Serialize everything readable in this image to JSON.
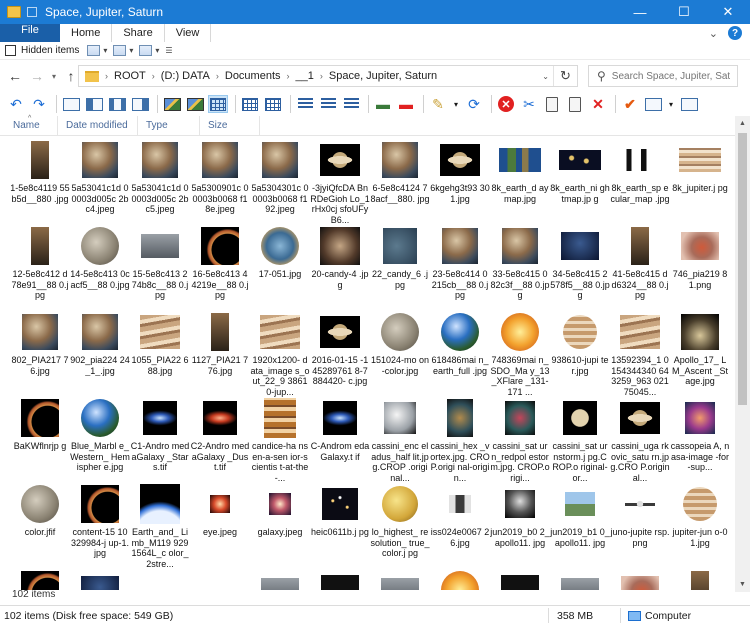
{
  "window": {
    "title": "Space, Jupiter, Saturn"
  },
  "ribbon": {
    "tabs": [
      "File",
      "Home",
      "Share",
      "View"
    ]
  },
  "options": {
    "hidden_items_label": "Hidden items"
  },
  "address": {
    "crumbs": [
      "ROOT",
      "(D:) DATA",
      "Documents",
      "__1",
      "Space, Jupiter, Saturn"
    ],
    "search_placeholder": "Search Space, Jupiter, Saturn"
  },
  "columns": {
    "name": "Name",
    "date": "Date modified",
    "type": "Type",
    "size": "Size"
  },
  "files": [
    {
      "name": "1-5e8c4119 55b5d__880 .jpg",
      "t": "spire"
    },
    {
      "name": "5a53041c1d 00003d005c 2bc4.jpeg",
      "t": "jupiter"
    },
    {
      "name": "5a53041c1d 00003d005c 2bc5.jpeg",
      "t": "jupiter"
    },
    {
      "name": "5a5300901c 00003b0068 f18e.jpeg",
      "t": "jupiter"
    },
    {
      "name": "5a5304301c 00003b0068 f192.jpeg",
      "t": "jupiter"
    },
    {
      "name": "-3jyiQfcDA BnRDeGioh Lo_1rHx0cj sfoUFyB6...",
      "t": "saturn"
    },
    {
      "name": "6-5e8c4124 78acf__880. jpg",
      "t": "jupiter"
    },
    {
      "name": "6kgehg3t93 301.jpg",
      "t": "saturn"
    },
    {
      "name": "8k_earth_d aymap.jpg",
      "t": "earthmap"
    },
    {
      "name": "8k_earth_ni ghtmap.jp g",
      "t": "night"
    },
    {
      "name": "8k_earth_sp ecular_map .jpg",
      "t": "specular"
    },
    {
      "name": "8k_jupiter.j pg",
      "t": "jupmap"
    },
    {
      "name": "12-5e8c412 d78e91__88 0.jpg",
      "t": "spire"
    },
    {
      "name": "14-5e8c413 0cacf5__88 0.jpg",
      "t": "moon"
    },
    {
      "name": "15-5e8c413 274b8c__88 0.jpg",
      "t": "grey"
    },
    {
      "name": "16-5e8c413 44219e__88 0.jpg",
      "t": "crescent"
    },
    {
      "name": "17-051.jpg",
      "t": "jupiterpole"
    },
    {
      "name": "20-candy-4 .jpg",
      "t": "jupiterdark"
    },
    {
      "name": "22_candy_6 .jpg",
      "t": "cloud"
    },
    {
      "name": "23-5e8c414 0215cb__88 0.jpg",
      "t": "jupiter"
    },
    {
      "name": "33-5e8c415 082c3f__88 0.jpg",
      "t": "jupiter"
    },
    {
      "name": "34-5e8c415 2578f5__88 0.jpg",
      "t": "bluedark"
    },
    {
      "name": "41-5e8c415 dd6324__88 0.jpg",
      "t": "spire"
    },
    {
      "name": "746_pia219 81.png",
      "t": "jupiterred"
    },
    {
      "name": "802_PIA217 76.jpg",
      "t": "jupiter"
    },
    {
      "name": "902_pia224 24_1_.jpg",
      "t": "jupiter"
    },
    {
      "name": "1055_PIA22 688.jpg",
      "t": "jupiterband"
    },
    {
      "name": "1127_PIA21 776.jpg",
      "t": "spire"
    },
    {
      "name": "1920x1200- data_image s_out_22_9 38610-jup...",
      "t": "jupiterband"
    },
    {
      "name": "2016-01-15 -145289761 8-7884420- c.jpg",
      "t": "saturn"
    },
    {
      "name": "151024-mo on-color.jpg",
      "t": "moon"
    },
    {
      "name": "618486mai n_earth_full .jpg",
      "t": "earth"
    },
    {
      "name": "748369mai n_SDO_Ma y_13_XFlare _131-171 ...",
      "t": "sun"
    },
    {
      "name": "938610-jupi ter.jpg",
      "t": "jupiterglobe"
    },
    {
      "name": "13592394_1 0154344340 643259_963 02175045...",
      "t": "jupiterband"
    },
    {
      "name": "Apollo_17_ LM_Ascent _Stage.jpg",
      "t": "lander"
    },
    {
      "name": "BaKWflnrjp g",
      "t": "crescent"
    },
    {
      "name": "Blue_Marbl e_Western_ Hemispher e.jpg",
      "t": "earth"
    },
    {
      "name": "C1-Andro medaGalaxy _Stars.tif",
      "t": "galaxy"
    },
    {
      "name": "C2-Andro medaGalaxy _Dust.tif",
      "t": "galaxyred"
    },
    {
      "name": "candice-ha nsen-a-sen ior-scientis t-at-the-...",
      "t": "jupitervert"
    },
    {
      "name": "C-Androm edaGalaxy.t if",
      "t": "galaxy"
    },
    {
      "name": "cassini_enc eladus_half lit.jpg.CROP .original...",
      "t": "enceladus"
    },
    {
      "name": "cassini_hex _vortex.jpg. CROP.origi nal-origin...",
      "t": "hexvortex"
    },
    {
      "name": "cassini_sat urn_redpol estorm.jpg. CROP.origi...",
      "t": "redstorm"
    },
    {
      "name": "cassini_sat urnstorm.j pg.CROP.o riginal-or...",
      "t": "saturnsmall"
    },
    {
      "name": "cassini_uga rkovic_satu rn.jpg.CRO P.original...",
      "t": "saturn"
    },
    {
      "name": "cassopeia A, nasa-image -for-sup...",
      "t": "nebula"
    },
    {
      "name": "color.jfif",
      "t": "moon"
    },
    {
      "name": "content-15 10329984-j up-1.jpg",
      "t": "crescent"
    },
    {
      "name": "Earth_and_ Limb_M119 9291564L_c olor_2stre...",
      "t": "earthlimb"
    },
    {
      "name": "eye.jpeg",
      "t": "eye"
    },
    {
      "name": "galaxy.jpeg",
      "t": "galaxysmall"
    },
    {
      "name": "heic0611b.j pg",
      "t": "stars"
    },
    {
      "name": "lo_highest_ resolution_ true_color.j pg",
      "t": "io"
    },
    {
      "name": "iss024e0067 26.jpg",
      "t": "iss"
    },
    {
      "name": "jun2019_b0 2_apollo11. jpg",
      "t": "astronaut"
    },
    {
      "name": "jun2019_b1 0_apollo11. jpg",
      "t": "landscape"
    },
    {
      "name": "juno-jupite rsp.png",
      "t": "junocraft"
    },
    {
      "name": "jupiter-jun o-01.jpg",
      "t": "jupiterglobe"
    },
    {
      "name": "",
      "t": "crescent"
    },
    {
      "name": "",
      "t": "bluedark"
    },
    {
      "name": "",
      "t": "none"
    },
    {
      "name": "",
      "t": "none"
    },
    {
      "name": "",
      "t": "grey"
    },
    {
      "name": "",
      "t": "dark"
    },
    {
      "name": "",
      "t": "grey"
    },
    {
      "name": "",
      "t": "sun"
    },
    {
      "name": "",
      "t": "dark"
    },
    {
      "name": "",
      "t": "grey"
    },
    {
      "name": "",
      "t": "jupiterred"
    },
    {
      "name": "",
      "t": "spire"
    }
  ],
  "status": {
    "items_count": "102 items",
    "left": "102 items (Disk free space: 549 GB)",
    "size": "358 MB",
    "location": "Computer"
  },
  "colors": {
    "titlebar": "#1c7bd4",
    "file_tab": "#1a5fa8"
  }
}
